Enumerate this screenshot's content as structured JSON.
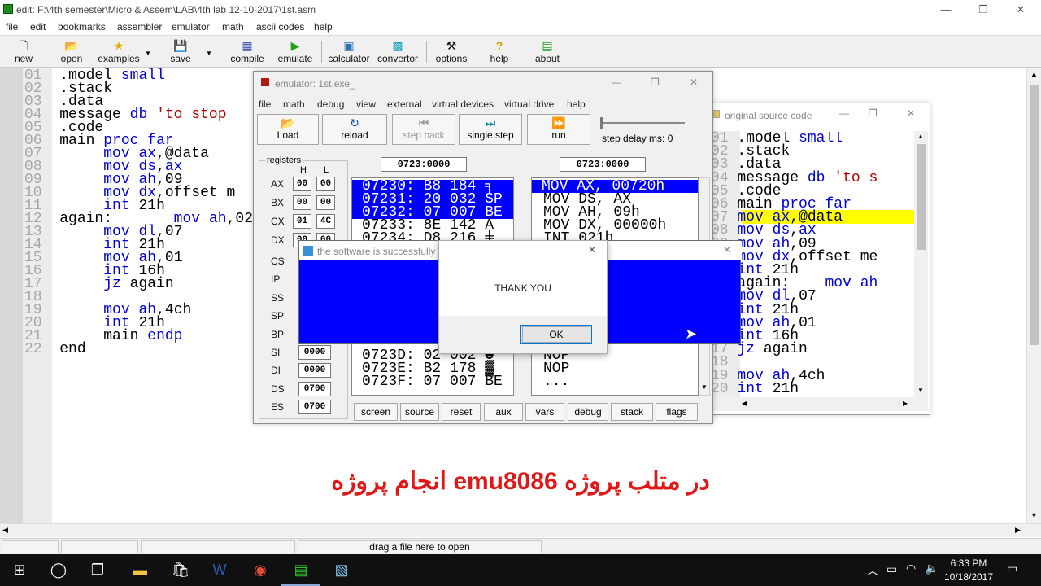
{
  "main_window": {
    "title": "edit: F:\\4th semester\\Micro & Assem\\LAB\\4th lab 12-10-2017\\1st.asm",
    "controls": {
      "minimize": "—",
      "maximize": "❐",
      "close": "✕"
    }
  },
  "menu": {
    "file": "file",
    "edit": "edit",
    "bookmarks": "bookmarks",
    "assembler": "assembler",
    "emulator": "emulator",
    "math": "math",
    "ascii_codes": "ascii codes",
    "help": "help"
  },
  "toolbar": {
    "new": "new",
    "open": "open",
    "examples": "examples",
    "save": "save",
    "compile": "compile",
    "emulate": "emulate",
    "calculator": "calculator",
    "convertor": "convertor",
    "options": "options",
    "help": "help",
    "about": "about"
  },
  "editor": {
    "lines": [
      {
        "n": "01",
        "t": ".model small"
      },
      {
        "n": "02",
        "t": ".stack"
      },
      {
        "n": "03",
        "t": ".data"
      },
      {
        "n": "04",
        "t": "message db 'to stop"
      },
      {
        "n": "05",
        "t": ".code"
      },
      {
        "n": "06",
        "t": "main proc far"
      },
      {
        "n": "07",
        "t": "     mov ax,@data"
      },
      {
        "n": "08",
        "t": "     mov ds,ax"
      },
      {
        "n": "09",
        "t": "     mov ah,09"
      },
      {
        "n": "10",
        "t": "     mov dx,offset m"
      },
      {
        "n": "11",
        "t": "     int 21h"
      },
      {
        "n": "12",
        "t": "again:       mov ah,02"
      },
      {
        "n": "13",
        "t": "     mov dl,07"
      },
      {
        "n": "14",
        "t": "     int 21h"
      },
      {
        "n": "15",
        "t": "     mov ah,01"
      },
      {
        "n": "16",
        "t": "     int 16h"
      },
      {
        "n": "17",
        "t": "     jz again"
      },
      {
        "n": "18",
        "t": ""
      },
      {
        "n": "19",
        "t": "     mov ah,4ch"
      },
      {
        "n": "20",
        "t": "     int 21h"
      },
      {
        "n": "21",
        "t": "     main endp"
      },
      {
        "n": "22",
        "t": "end"
      }
    ]
  },
  "status": {
    "drag_hint": "drag a file here to open"
  },
  "emulator": {
    "title": "emulator: 1st.exe_",
    "menu": [
      "file",
      "math",
      "debug",
      "view",
      "external",
      "virtual devices",
      "virtual drive",
      "help"
    ],
    "buttons": {
      "load": "Load",
      "reload": "reload",
      "step_back": "step back",
      "single_step": "single step",
      "run": "run"
    },
    "step_delay": "step delay ms: 0",
    "registers_label": "registers",
    "col_h": "H",
    "col_l": "L",
    "regs": [
      {
        "name": "AX",
        "h": "00",
        "l": "00"
      },
      {
        "name": "BX",
        "h": "00",
        "l": "00"
      },
      {
        "name": "CX",
        "h": "01",
        "l": "4C"
      },
      {
        "name": "DX",
        "h": "00",
        "l": "00"
      }
    ],
    "regs16": [
      {
        "name": "CS",
        "v": ""
      },
      {
        "name": "IP",
        "v": ""
      },
      {
        "name": "SS",
        "v": ""
      },
      {
        "name": "SP",
        "v": ""
      },
      {
        "name": "BP",
        "v": ""
      },
      {
        "name": "SI",
        "v": "0000"
      },
      {
        "name": "DI",
        "v": "0000"
      },
      {
        "name": "DS",
        "v": "0700"
      },
      {
        "name": "ES",
        "v": "0700"
      }
    ],
    "addr_left": "0723:0000",
    "addr_right": "0723:0000",
    "memory_top": [
      "07230: B8 184 ╕",
      "07231: 20 032 SP",
      "07232: 07 007 BE",
      "07233: 8E 142 Ä",
      "07234: D8 216 ╪"
    ],
    "memory_bottom": [
      "0723D: 02 002 ☻",
      "0723E: B2 178 ▓",
      "0723F: 07 007 BE"
    ],
    "disasm_top": [
      "MOV AX, 00720h",
      "MOV DS, AX",
      "MOV AH, 09h",
      "MOV DX, 00000h",
      "INT 021h"
    ],
    "disasm_bottom": [
      "NOP",
      "NOP",
      "..."
    ],
    "bottom_buttons": [
      "screen",
      "source",
      "reset",
      "aux",
      "vars",
      "debug",
      "stack",
      "flags"
    ]
  },
  "source_window": {
    "title": "original source code",
    "lines": [
      {
        "n": "01",
        "t": ".model small"
      },
      {
        "n": "02",
        "t": ".stack"
      },
      {
        "n": "03",
        "t": ".data"
      },
      {
        "n": "04",
        "t": "message db 'to s"
      },
      {
        "n": "05",
        "t": ".code"
      },
      {
        "n": "06",
        "t": "main proc far"
      },
      {
        "n": "07",
        "t": "mov ax,@data"
      },
      {
        "n": "08",
        "t": "mov ds,ax"
      },
      {
        "n": "09",
        "t": "mov ah,09"
      },
      {
        "n": "10",
        "t": "mov dx,offset me"
      },
      {
        "n": "11",
        "t": "int 21h"
      },
      {
        "n": "12",
        "t": "again:    mov ah"
      },
      {
        "n": "13",
        "t": "mov dl,07"
      },
      {
        "n": "14",
        "t": "int 21h"
      },
      {
        "n": "15",
        "t": "mov ah,01"
      },
      {
        "n": "16",
        "t": "int 16h"
      },
      {
        "n": "17",
        "t": "jz again"
      },
      {
        "n": "18",
        "t": ""
      },
      {
        "n": "19",
        "t": "mov ah,4ch"
      },
      {
        "n": "20",
        "t": "int 21h"
      }
    ]
  },
  "message_window": {
    "title": "the software is successfully r"
  },
  "dialog": {
    "message": "THANK YOU",
    "ok": "OK"
  },
  "overlay": {
    "text": "در متلب پروژه emu8086 انجام پروژه"
  },
  "taskbar": {
    "time": "6:33 PM",
    "date": "10/18/2017"
  },
  "colors": {
    "blue": "#0000ff",
    "highlight": "#ffff00",
    "keyword": "#0000d8",
    "string": "#b00000",
    "overlay": "#e11818"
  }
}
